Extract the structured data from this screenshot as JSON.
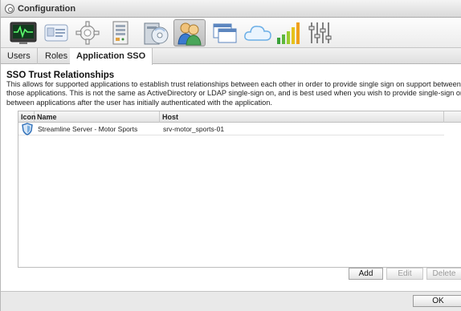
{
  "window": {
    "title": "Configuration"
  },
  "toolbar": {
    "items": [
      {
        "icon": "monitor-icon"
      },
      {
        "icon": "id-card-icon"
      },
      {
        "icon": "gear-icon"
      },
      {
        "icon": "server-icon"
      },
      {
        "icon": "media-drive-icon"
      },
      {
        "icon": "users-icon",
        "active": true
      },
      {
        "icon": "windows-icon"
      },
      {
        "icon": "cloud-icon"
      },
      {
        "icon": "signal-bars-icon"
      },
      {
        "icon": "sliders-icon"
      }
    ]
  },
  "tabs": [
    {
      "label": "Users"
    },
    {
      "label": "Roles"
    },
    {
      "label": "Application SSO",
      "active": true
    }
  ],
  "section": {
    "title": "SSO Trust Relationships",
    "description": "This allows for supported applications to establish trust relationships between each other in order to provide single sign on support between those applications. This is not the same as ActiveDirectory or LDAP single-sign on, and is best used when you wish to provide single-sign on between applications after the user has initially authenticated with the application."
  },
  "table": {
    "columns": [
      "Icon",
      "Name",
      "Host"
    ],
    "rows": [
      {
        "icon": "shield-icon",
        "name": "Streamline Server - Motor Sports",
        "host": "srv-motor_sports-01"
      }
    ]
  },
  "buttons": {
    "add": "Add",
    "edit": "Edit",
    "delete": "Delete",
    "ok": "OK"
  },
  "colors": {
    "shield": "#2f6fb8",
    "active_tool": "#c8c8c8"
  }
}
